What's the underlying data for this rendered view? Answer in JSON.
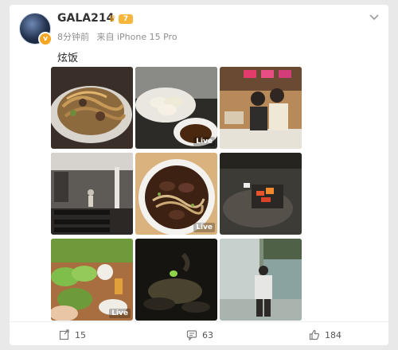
{
  "user": {
    "name": "GALA214",
    "vip_badge": "7",
    "verified_mark": "v"
  },
  "meta": {
    "time": "8分钟前",
    "source": "来自 iPhone 15 Pro"
  },
  "post": {
    "text": "炫饭"
  },
  "photos": [
    {
      "name": "noodles-plate",
      "live": ""
    },
    {
      "name": "dumplings-bowl",
      "live": "Live"
    },
    {
      "name": "friends-at-restaurant",
      "live": ""
    },
    {
      "name": "gym-interior",
      "live": ""
    },
    {
      "name": "beef-noodle-soup",
      "live": "Live"
    },
    {
      "name": "grill-fire",
      "live": ""
    },
    {
      "name": "lettuce-wrap-meal",
      "live": "Live"
    },
    {
      "name": "night-stream",
      "live": ""
    },
    {
      "name": "man-by-waterfall",
      "live": ""
    }
  ],
  "actions": {
    "reposts": "15",
    "comments": "63",
    "likes": "184"
  },
  "icons": {
    "repost": "repost-icon",
    "comment": "comment-icon",
    "like": "like-icon",
    "dropdown": "chevron-down-icon"
  },
  "colors": {
    "vip": "#f6b53b",
    "muted": "#8f8f8f"
  }
}
